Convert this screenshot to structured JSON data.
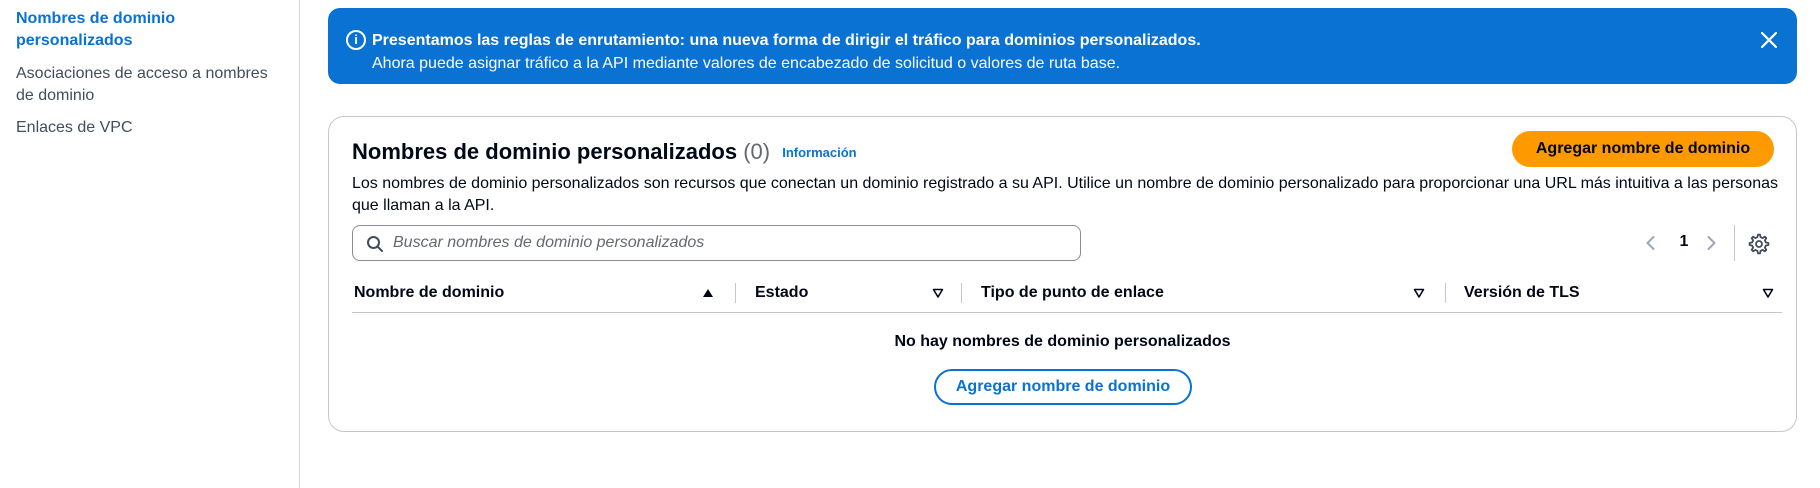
{
  "sidebar": {
    "items": [
      {
        "label": "Nombres de dominio personalizados",
        "active": true
      },
      {
        "label": "Asociaciones de acceso a nombres de dominio",
        "active": false
      },
      {
        "label": "Enlaces de VPC",
        "active": false
      }
    ]
  },
  "flash": {
    "type": "info",
    "icon": "info-icon",
    "title": "Presentamos las reglas de enrutamiento: una nueva forma de dirigir el tráfico para dominios personalizados.",
    "text": "Ahora puede asignar tráfico a la API mediante valores de encabezado de solicitud o valores de ruta base.",
    "close_icon": "close-icon",
    "color": "#0972d3"
  },
  "container": {
    "title": "Nombres de dominio personalizados",
    "count": "(0)",
    "info_link": "Información",
    "primary_button": "Agregar nombre de dominio",
    "primary_color": "#ff9900",
    "description": "Los nombres de dominio personalizados son recursos que conectan un dominio registrado a su API. Utilice un nombre de dominio personalizado para proporcionar una URL más intuitiva a las personas que llaman a la API.",
    "search": {
      "placeholder": "Buscar nombres de dominio personalizados",
      "value": "",
      "icon": "search-icon"
    },
    "pagination": {
      "current_page": "1",
      "prev_icon": "chevron-left-icon",
      "next_icon": "chevron-right-icon",
      "settings_icon": "gear-icon"
    },
    "columns": [
      {
        "label": "Nombre de dominio",
        "sort": "ascending"
      },
      {
        "label": "Estado",
        "sort": "none"
      },
      {
        "label": "Tipo de punto de enlace",
        "sort": "none"
      },
      {
        "label": "Versión de TLS",
        "sort": "none"
      }
    ],
    "empty_state": {
      "title": "No hay nombres de dominio personalizados",
      "button": "Agregar nombre de dominio"
    }
  }
}
